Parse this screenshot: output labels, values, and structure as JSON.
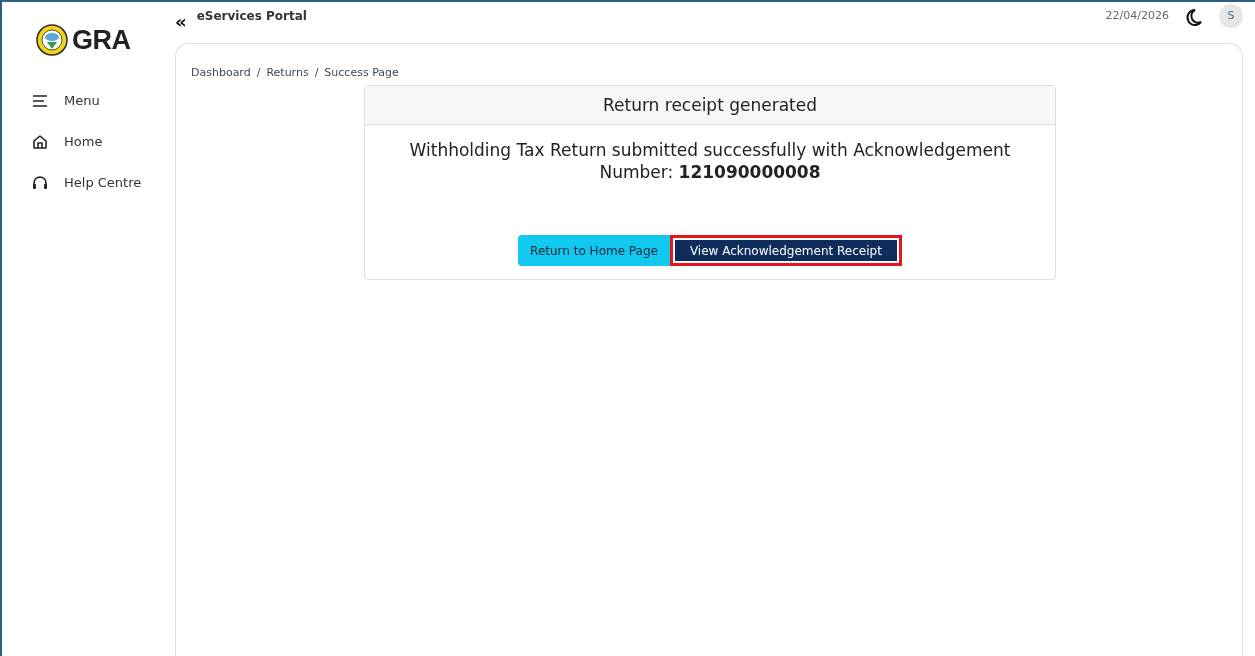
{
  "logo": {
    "text": "GRA"
  },
  "sidebar": {
    "items": [
      {
        "label": "Menu",
        "kind": "menu"
      },
      {
        "label": "Home",
        "kind": "home"
      },
      {
        "label": "Help Centre",
        "kind": "help"
      }
    ]
  },
  "header": {
    "collapse_icon": "«",
    "title": "eServices Portal",
    "date": "22/04/2026",
    "avatar": "S"
  },
  "breadcrumb": [
    "Dashboard",
    "Returns",
    "Success Page"
  ],
  "breadcrumb_separator": "/",
  "card": {
    "title": "Return receipt generated",
    "message": "Withholding Tax Return submitted successfully with Acknowledgement Number: **121090000008**",
    "buttons": [
      {
        "label": "Return to Home Page",
        "kind": "secondary",
        "highlighted": false
      },
      {
        "label": "View Acknowledgement Receipt",
        "kind": "primary",
        "highlighted": true
      }
    ]
  }
}
